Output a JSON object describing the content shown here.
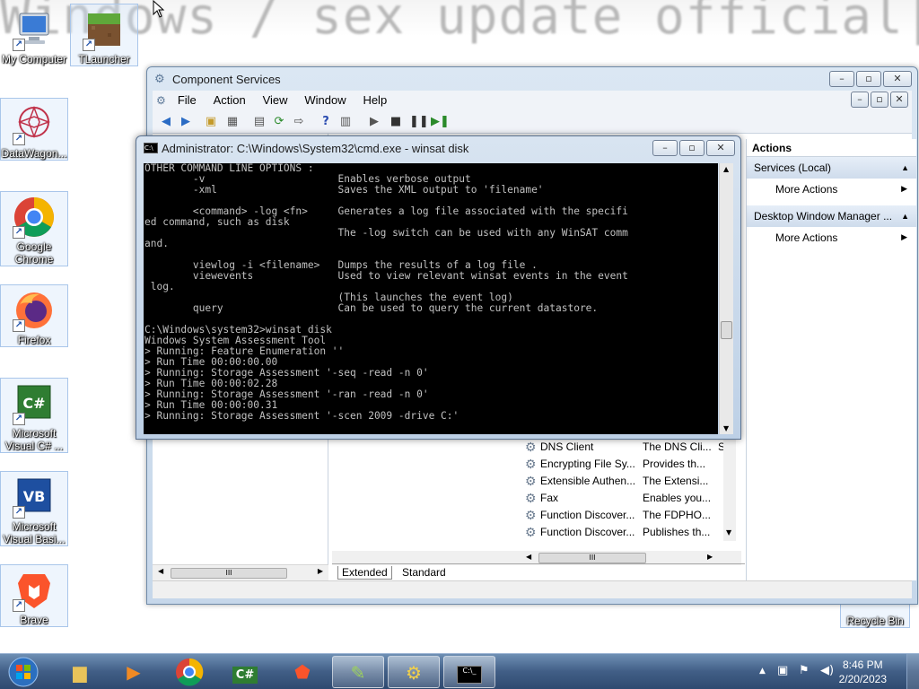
{
  "wallpaper": {
    "text": "Windows / sex update official|"
  },
  "desktop_icons": [
    {
      "label": "My Computer"
    },
    {
      "label": "TLauncher"
    },
    {
      "label": "DataWagon..."
    },
    {
      "label": "Google Chrome"
    },
    {
      "label": "Firefox"
    },
    {
      "label": "Microsoft Visual C# ..."
    },
    {
      "label": "Microsoft Visual Basi..."
    },
    {
      "label": "Brave"
    },
    {
      "label": "Recycle Bin"
    }
  ],
  "component_services": {
    "title": "Component Services",
    "menu": [
      "File",
      "Action",
      "View",
      "Window",
      "Help"
    ],
    "actions_header": "Actions",
    "action_sections": [
      {
        "title": "Services (Local)",
        "item": "More Actions"
      },
      {
        "title": "Desktop Window Manager ...",
        "item": "More Actions"
      }
    ],
    "services": [
      {
        "name": "DNS Client",
        "description": "The DNS Cli...",
        "status": "S"
      },
      {
        "name": "Encrypting File Sy...",
        "description": "Provides th...",
        "status": ""
      },
      {
        "name": "Extensible Authen...",
        "description": "The Extensi...",
        "status": ""
      },
      {
        "name": "Fax",
        "description": "Enables you...",
        "status": ""
      },
      {
        "name": "Function Discover...",
        "description": "The FDPHO...",
        "status": ""
      },
      {
        "name": "Function Discover...",
        "description": "Publishes th...",
        "status": ""
      }
    ],
    "tabs": [
      "Extended",
      "Standard"
    ],
    "scroll_grip": "III"
  },
  "cmd": {
    "title": "Administrator: C:\\Windows\\System32\\cmd.exe - winsat  disk",
    "lines": [
      "OTHER COMMAND LINE OPTIONS :",
      "        -v                      Enables verbose output",
      "        -xml                    Saves the XML output to 'filename'",
      "",
      "        <command> -log <fn>     Generates a log file associated with the specifi",
      "ed command, such as disk",
      "                                The -log switch can be used with any WinSAT comm",
      "and.",
      "",
      "        viewlog -i <filename>   Dumps the results of a log file .",
      "        viewevents              Used to view relevant winsat events in the event",
      " log.",
      "                                (This launches the event log)",
      "        query                   Can be used to query the current datastore.",
      "",
      "C:\\Windows\\system32>winsat disk",
      "Windows System Assessment Tool",
      "> Running: Feature Enumeration ''",
      "> Run Time 00:00:00.00",
      "> Running: Storage Assessment '-seq -read -n 0'",
      "> Run Time 00:00:02.28",
      "> Running: Storage Assessment '-ran -read -n 0'",
      "> Run Time 00:00:00.31",
      "> Running: Storage Assessment '-scen 2009 -drive C:'"
    ]
  },
  "taskbar": {
    "time": "8:46 PM",
    "date": "2/20/2023"
  }
}
